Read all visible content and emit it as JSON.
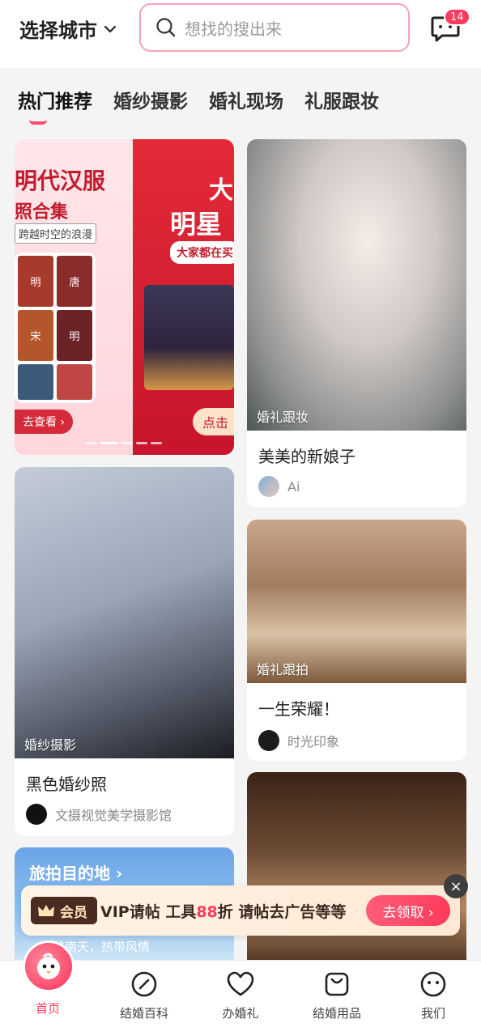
{
  "header": {
    "city": "选择城市",
    "search_placeholder": "想找的搜出来",
    "message_badge": "14"
  },
  "tabs": [
    {
      "label": "热门推荐",
      "active": true
    },
    {
      "label": "婚纱摄影",
      "active": false
    },
    {
      "label": "婚礼现场",
      "active": false
    },
    {
      "label": "礼服跟妆",
      "active": false
    }
  ],
  "banner": {
    "left_title": "明代汉服",
    "left_subtitle": "照合集",
    "left_tag": "跨越时空的浪漫",
    "photo_labels": [
      "明",
      "唐",
      "宋",
      "明"
    ],
    "view_button": "去查看 ›",
    "right_big": "大",
    "right_star": "明星",
    "right_label": "大家都在买",
    "right_click": "点击"
  },
  "cards": {
    "bride": {
      "tag": "婚礼跟妆",
      "title": "美美的新娘子",
      "author": "Ai"
    },
    "couple": {
      "tag": "婚纱摄影",
      "title": "黑色婚纱照",
      "author": "文摄视觉美学摄影馆"
    },
    "scene": {
      "tag": "婚礼跟拍",
      "title": "一生荣耀！",
      "author": "时光印象"
    },
    "travel": {
      "title": "旅拍目的地 ›",
      "subtitle": "醉美南天，热带风情"
    }
  },
  "promo": {
    "vip_label": "会员",
    "text_prefix": "VIP请帖 工具",
    "text_highlight": "88",
    "text_suffix": "折 请帖去广告等等",
    "button": "去领取 ›",
    "close": "×"
  },
  "bottom_nav": [
    {
      "label": "首页",
      "icon": "home-bird-icon",
      "active": true
    },
    {
      "label": "结婚百科",
      "icon": "compass-icon",
      "active": false
    },
    {
      "label": "办婚礼",
      "icon": "heart-icon",
      "active": false
    },
    {
      "label": "结婚用品",
      "icon": "shopping-bag-icon",
      "active": false
    },
    {
      "label": "我们",
      "icon": "smiley-icon",
      "active": false
    }
  ],
  "colors": {
    "accent": "#ff3a5c",
    "search_border": "#f4a3b3",
    "banner_red": "#c21d2e"
  }
}
